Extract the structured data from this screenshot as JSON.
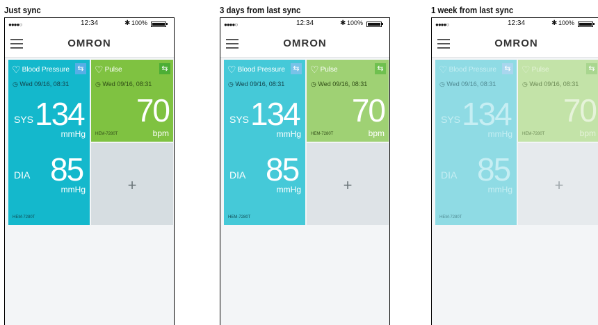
{
  "panels": [
    {
      "caption": "Just sync",
      "status": {
        "signal": "●●●●○",
        "time": "12:34",
        "bluetooth": "✱",
        "battery": "100%"
      },
      "brand": "OMRON",
      "bp": {
        "title": "Blood Pressure",
        "date": "Wed 09/16, 08:31",
        "sys_label": "SYS",
        "sys": "134",
        "sys_unit": "mmHg",
        "dia_label": "DIA",
        "dia": "85",
        "dia_unit": "mmHg",
        "model": "HEM-7280T"
      },
      "pulse": {
        "title": "Pulse",
        "date": "Wed 09/16, 08:31",
        "value": "70",
        "unit": "bpm",
        "model": "HEM-7280T"
      },
      "add_symbol": "+"
    },
    {
      "caption": "3 days from last sync",
      "status": {
        "signal": "●●●●○",
        "time": "12:34",
        "bluetooth": "✱",
        "battery": "100%"
      },
      "brand": "OMRON",
      "bp": {
        "title": "Blood Pressure",
        "date": "Wed 09/16, 08:31",
        "sys_label": "SYS",
        "sys": "134",
        "sys_unit": "mmHg",
        "dia_label": "DIA",
        "dia": "85",
        "dia_unit": "mmHg",
        "model": "HEM-7280T"
      },
      "pulse": {
        "title": "Pulse",
        "date": "Wed 09/16, 08:31",
        "value": "70",
        "unit": "bpm",
        "model": "HEM-7280T"
      },
      "add_symbol": "+"
    },
    {
      "caption": "1 week from last sync",
      "status": {
        "signal": "●●●●○",
        "time": "12:34",
        "bluetooth": "✱",
        "battery": "100%"
      },
      "brand": "OMRON",
      "bp": {
        "title": "Blood Pressure",
        "date": "Wed 09/16, 08:31",
        "sys_label": "SYS",
        "sys": "134",
        "sys_unit": "mmHg",
        "dia_label": "DIA",
        "dia": "85",
        "dia_unit": "mmHg",
        "model": "HEM-7280T"
      },
      "pulse": {
        "title": "Pulse",
        "date": "Wed 09/16, 08:31",
        "value": "70",
        "unit": "bpm",
        "model": "HEM-7280T"
      },
      "add_symbol": "+"
    }
  ],
  "colors": {
    "bp_fresh": "#14b8cc",
    "bp_3days": "#45c9d8",
    "bp_week": "#8fdbe4",
    "pulse_fresh": "#7fc241",
    "pulse_3days": "#9fd174",
    "pulse_week": "#c3e3a8"
  }
}
